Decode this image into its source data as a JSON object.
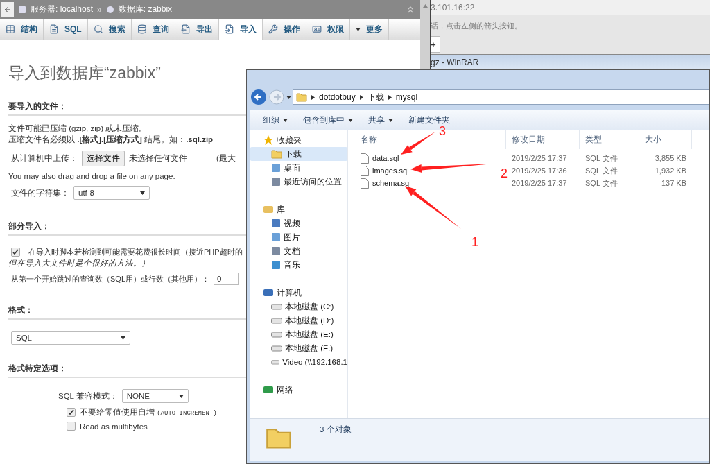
{
  "browser_window": {
    "breadcrumb": [
      {
        "label": "服务器: localhost"
      },
      {
        "label": "数据库: zabbix",
        "separator": "»"
      }
    ],
    "tabs": [
      {
        "label": "结构",
        "selected": false
      },
      {
        "label": "SQL",
        "selected": false
      },
      {
        "label": "搜索",
        "selected": false
      },
      {
        "label": "查询",
        "selected": false
      },
      {
        "label": "导出",
        "selected": false
      },
      {
        "label": "导入",
        "selected": true
      },
      {
        "label": "操作",
        "selected": false
      },
      {
        "label": "权限",
        "selected": false
      },
      {
        "label": "更多",
        "selected": false
      }
    ],
    "heading": "导入到数据库“zabbix”",
    "file_section": {
      "title": "要导入的文件：",
      "notes": [
        "文件可能已压缩 (gzip, zip) 或未压缩。",
        "压缩文件名必须以 **.[格式].[压缩方式]** 结尾。如：**.sql.zip**"
      ],
      "upload_label": "从计算机中上传：",
      "choose_button": "选择文件",
      "no_file": "未选择任何文件",
      "max_size": "(最大",
      "drag_hint": "You may also drag and drop a file on any page.",
      "charset_label": "文件的字符集：",
      "charset_value": "utf-8"
    },
    "partial_section": {
      "title": "部分导入：",
      "interrupt": {
        "label": "在导入时脚本若检测到可能需要花费很长时间（接近PHP超时的",
        "checked": true
      },
      "interrupt_note": "但在导入大文件时是个很好的方法。）",
      "skip_label": "从第一个开始跳过的查询数（SQL用）或行数（其他用）：",
      "skip_value": "0"
    },
    "format_section": {
      "title": "格式：",
      "value": "SQL"
    },
    "options_section": {
      "title": "格式特定选项：",
      "compat_label": "SQL 兼容模式：",
      "compat_value": "NONE",
      "options": [
        {
          "label": "不要给零值使用自增",
          "code": "(AUTO_INCREMENT)",
          "checked": true
        },
        {
          "label": "Read as multibytes",
          "checked": false
        }
      ]
    }
  },
  "back_window": {
    "address": "3.101.16:22",
    "message": "话，点击左侧的箭头按钮。",
    "tab": "+",
    "winrar_title": "gz - WinRAR"
  },
  "explorer": {
    "path": [
      "dotdotbuy",
      "下载",
      "mysql"
    ],
    "toolbar": [
      {
        "label": "组织",
        "dropdown": true
      },
      {
        "label": "包含到库中",
        "dropdown": true
      },
      {
        "label": "共享",
        "dropdown": true
      },
      {
        "label": "新建文件夹",
        "dropdown": false
      }
    ],
    "nav": [
      {
        "label": "收藏夹",
        "children": [
          {
            "label": "下载",
            "selected": true
          },
          {
            "label": "桌面",
            "selected": false
          },
          {
            "label": "最近访问的位置",
            "selected": false
          }
        ]
      },
      {
        "label": "库",
        "children": [
          {
            "label": "视频",
            "selected": false
          },
          {
            "label": "图片",
            "selected": false
          },
          {
            "label": "文档",
            "selected": false
          },
          {
            "label": "音乐",
            "selected": false
          }
        ]
      },
      {
        "label": "计算机",
        "children": [
          {
            "label": "本地磁盘 (C:)",
            "selected": false
          },
          {
            "label": "本地磁盘 (D:)",
            "selected": false
          },
          {
            "label": "本地磁盘 (E:)",
            "selected": false
          },
          {
            "label": "本地磁盘 (F:)",
            "selected": false
          },
          {
            "label": "Video (\\\\192.168.1",
            "selected": false
          }
        ]
      },
      {
        "label": "网络"
      }
    ],
    "columns": [
      "名称",
      "修改日期",
      "类型",
      "大小"
    ],
    "rows": [
      {
        "name": "data.sql",
        "date": "2019/2/25 17:37",
        "type": "SQL 文件",
        "size": "3,855 KB"
      },
      {
        "name": "images.sql",
        "date": "2019/2/25 17:36",
        "type": "SQL 文件",
        "size": "1,932 KB"
      },
      {
        "name": "schema.sql",
        "date": "2019/2/25 17:37",
        "type": "SQL 文件",
        "size": "137 KB"
      }
    ],
    "status": "3 个对象"
  },
  "annotations": [
    {
      "label": "3"
    },
    {
      "label": "2"
    },
    {
      "label": "1"
    }
  ]
}
